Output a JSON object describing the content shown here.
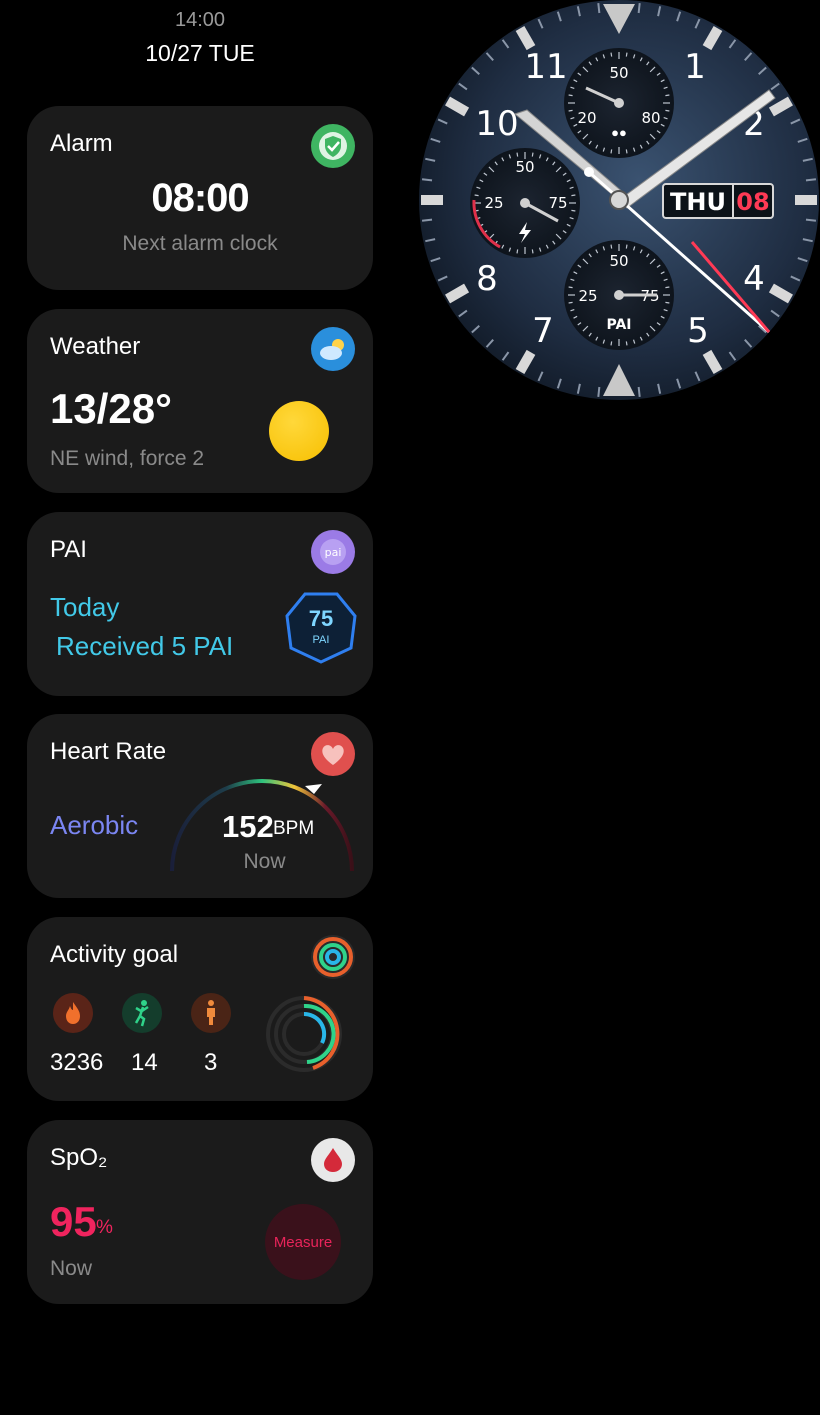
{
  "status": {
    "time": "14:00",
    "date": "10/27 TUE"
  },
  "alarm": {
    "title": "Alarm",
    "time": "08:00",
    "subtitle": "Next alarm clock",
    "icon": "alarm-shield-icon"
  },
  "weather": {
    "title": "Weather",
    "temperature": "13/28°",
    "wind": "NE wind, force 2",
    "icon": "cloud-sun-icon",
    "condition_icon": "sun-icon"
  },
  "pai": {
    "title": "PAI",
    "today": "Today",
    "received": "Received 5 PAI",
    "value": "75",
    "label": "PAI",
    "badge_text": "pai"
  },
  "heart": {
    "title": "Heart Rate",
    "zone": "Aerobic",
    "bpm": "152",
    "unit": "BPM",
    "when": "Now",
    "icon": "heart-icon"
  },
  "activity": {
    "title": "Activity goal",
    "items": [
      {
        "icon": "calorie-flame-icon",
        "value": "3236",
        "color": "#e8602c"
      },
      {
        "icon": "exercise-figure-icon",
        "value": "14",
        "color": "#2fd38a"
      },
      {
        "icon": "standing-figure-icon",
        "value": "3",
        "color": "#f08a3c"
      }
    ]
  },
  "spo2": {
    "title": "SpO₂",
    "value": "95",
    "unit": "%",
    "when": "Now",
    "measure_label": "Measure",
    "icon": "blood-drop-icon"
  },
  "watchface": {
    "numerals": [
      "11",
      "1",
      "10",
      "2",
      "8",
      "4",
      "7",
      "5"
    ],
    "day": "THU",
    "date": "08",
    "subdial_top": [
      "50",
      "20",
      "80"
    ],
    "subdial_left": [
      "50",
      "25",
      "75"
    ],
    "subdial_bottom": [
      "50",
      "25",
      "75",
      "PAI"
    ]
  },
  "colors": {
    "accent_cyan": "#42c9e8",
    "aerobic_blue": "#7b86f2",
    "spo2_red": "#f0245e",
    "card_bg": "#1b1b1b"
  }
}
